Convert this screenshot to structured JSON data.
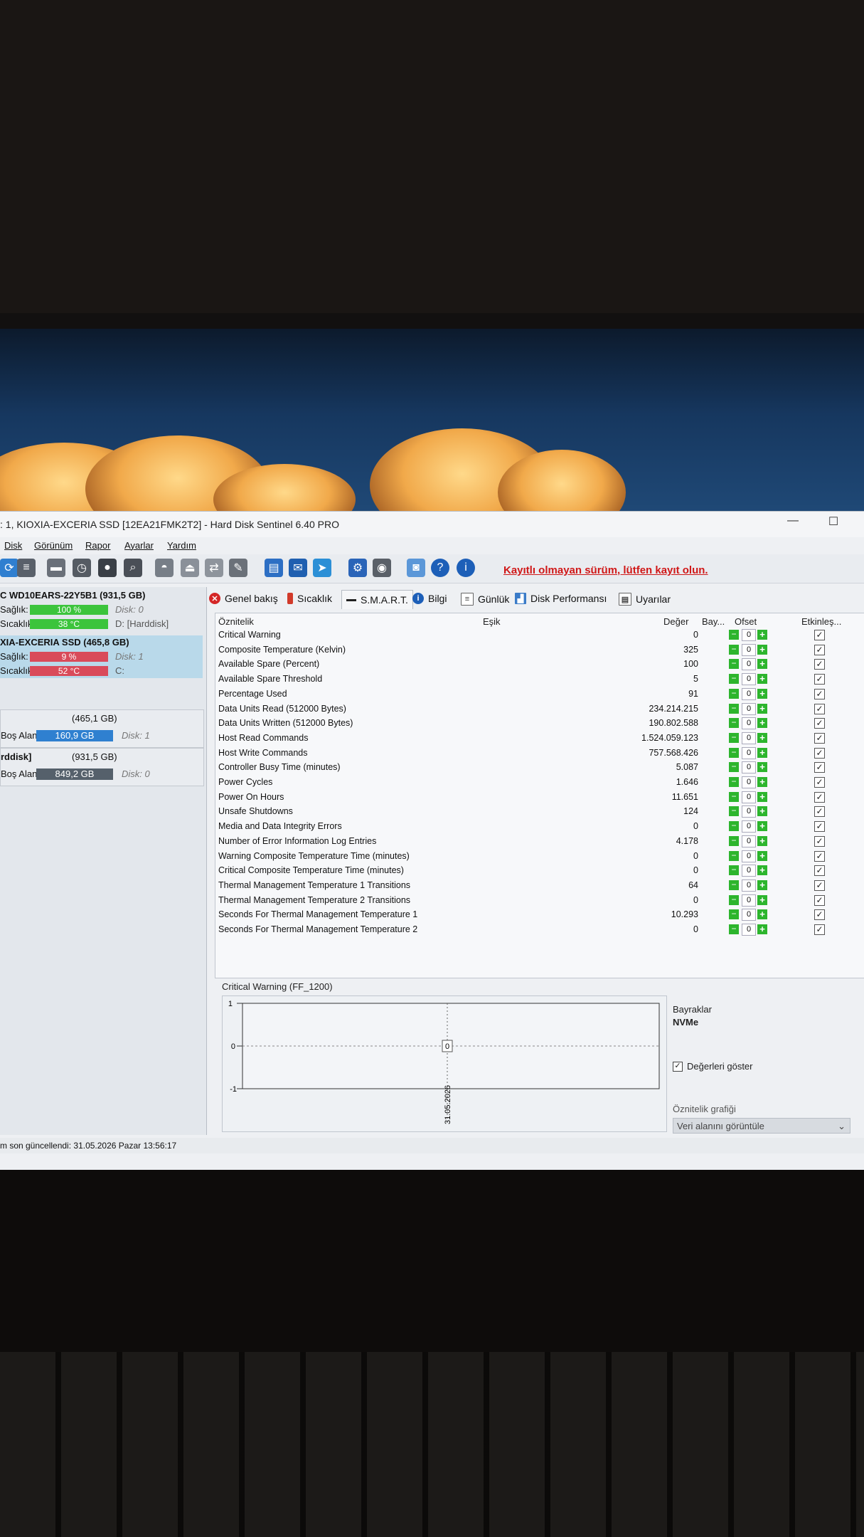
{
  "window": {
    "title": ": 1, KIOXIA-EXCERIA SSD [12EA21FMK2T2]  -  Hard Disk Sentinel 6.40 PRO",
    "minimize": "—",
    "maximize": "☐"
  },
  "menu": [
    "Disk",
    "Görünüm",
    "Rapor",
    "Ayarlar",
    "Yardım"
  ],
  "toolbar": {
    "registration_notice": "Kayıtlı olmayan sürüm, lütfen kayıt olun."
  },
  "disks": [
    {
      "name": "C WD10EARS-22Y5B1 (931,5 GB)",
      "health_label": "Sağlık:",
      "health_value": "100 %",
      "health_pct": 100,
      "health_aux": "Disk: 0",
      "temp_label": "Sıcaklık:",
      "temp_value": "38 °C",
      "temp_aux": "D: [Harddisk]",
      "color": "#3cc43c"
    },
    {
      "name": "XIA-EXCERIA SSD (465,8 GB)",
      "health_label": "Sağlık:",
      "health_value": "9 %",
      "health_pct": 9,
      "health_aux": "Disk: 1",
      "temp_label": "Sıcaklık:",
      "temp_value": "52 °C",
      "temp_aux": "C:",
      "color": "#d94b5a"
    }
  ],
  "volumes": [
    {
      "title": "(465,1 GB)",
      "label": "Boş Alan",
      "value": "160,9 GB",
      "aux": "Disk: 1"
    },
    {
      "title_bold": "rddisk]",
      "title": "(931,5 GB)",
      "label": "Boş Alan",
      "value": "849,2 GB",
      "aux": "Disk: 0"
    }
  ],
  "status": "m son güncellendi: 31.05.2026 Pazar 13:56:17",
  "tabs": [
    {
      "label": "Genel bakış",
      "icon": "error-icon"
    },
    {
      "label": "Sıcaklık",
      "icon": "thermometer-icon"
    },
    {
      "label": "S.M.A.R.T.",
      "icon": "smart-icon"
    },
    {
      "label": "Bilgi",
      "icon": "info-icon"
    },
    {
      "label": "Günlük",
      "icon": "log-icon"
    },
    {
      "label": "Disk Performansı",
      "icon": "chart-icon"
    },
    {
      "label": "Uyarılar",
      "icon": "alert-icon"
    }
  ],
  "smart": {
    "headers": {
      "attribute": "Öznitelik",
      "threshold": "Eşik",
      "value": "Değer",
      "flags": "Bay...",
      "offset": "Ofset",
      "enabled": "Etkinleş..."
    },
    "rows": [
      {
        "attr": "Critical Warning",
        "value": "0",
        "offset": "0"
      },
      {
        "attr": "Composite Temperature (Kelvin)",
        "value": "325",
        "offset": "0"
      },
      {
        "attr": "Available Spare (Percent)",
        "value": "100",
        "offset": "0"
      },
      {
        "attr": "Available Spare Threshold",
        "value": "5",
        "offset": "0"
      },
      {
        "attr": "Percentage Used",
        "value": "91",
        "offset": "0"
      },
      {
        "attr": "Data Units Read (512000 Bytes)",
        "value": "234.214.215",
        "offset": "0"
      },
      {
        "attr": "Data Units Written (512000 Bytes)",
        "value": "190.802.588",
        "offset": "0"
      },
      {
        "attr": "Host Read Commands",
        "value": "1.524.059.123",
        "offset": "0"
      },
      {
        "attr": "Host Write Commands",
        "value": "757.568.426",
        "offset": "0"
      },
      {
        "attr": "Controller Busy Time (minutes)",
        "value": "5.087",
        "offset": "0"
      },
      {
        "attr": "Power Cycles",
        "value": "1.646",
        "offset": "0"
      },
      {
        "attr": "Power On Hours",
        "value": "11.651",
        "offset": "0"
      },
      {
        "attr": "Unsafe Shutdowns",
        "value": "124",
        "offset": "0"
      },
      {
        "attr": "Media and Data Integrity Errors",
        "value": "0",
        "offset": "0"
      },
      {
        "attr": "Number of Error Information Log Entries",
        "value": "4.178",
        "offset": "0"
      },
      {
        "attr": "Warning Composite Temperature Time (minutes)",
        "value": "0",
        "offset": "0"
      },
      {
        "attr": "Critical Composite Temperature Time (minutes)",
        "value": "0",
        "offset": "0"
      },
      {
        "attr": "Thermal Management Temperature 1 Transitions",
        "value": "64",
        "offset": "0"
      },
      {
        "attr": "Thermal Management Temperature 2 Transitions",
        "value": "0",
        "offset": "0"
      },
      {
        "attr": "Seconds For Thermal Management Temperature 1",
        "value": "10.293",
        "offset": "0"
      },
      {
        "attr": "Seconds For Thermal Management Temperature 2",
        "value": "0",
        "offset": "0"
      }
    ]
  },
  "graph": {
    "title": "Critical Warning (FF_1200)",
    "y_ticks": [
      "1",
      "0",
      "-1"
    ],
    "x_label": "31.05.2026",
    "point_label": "0"
  },
  "side": {
    "flags_label": "Bayraklar",
    "flags_value": "NVMe",
    "show_values": "Değerleri göster",
    "graph_label": "Öznitelik grafiği",
    "select_value": "Veri alanını görüntüle"
  }
}
